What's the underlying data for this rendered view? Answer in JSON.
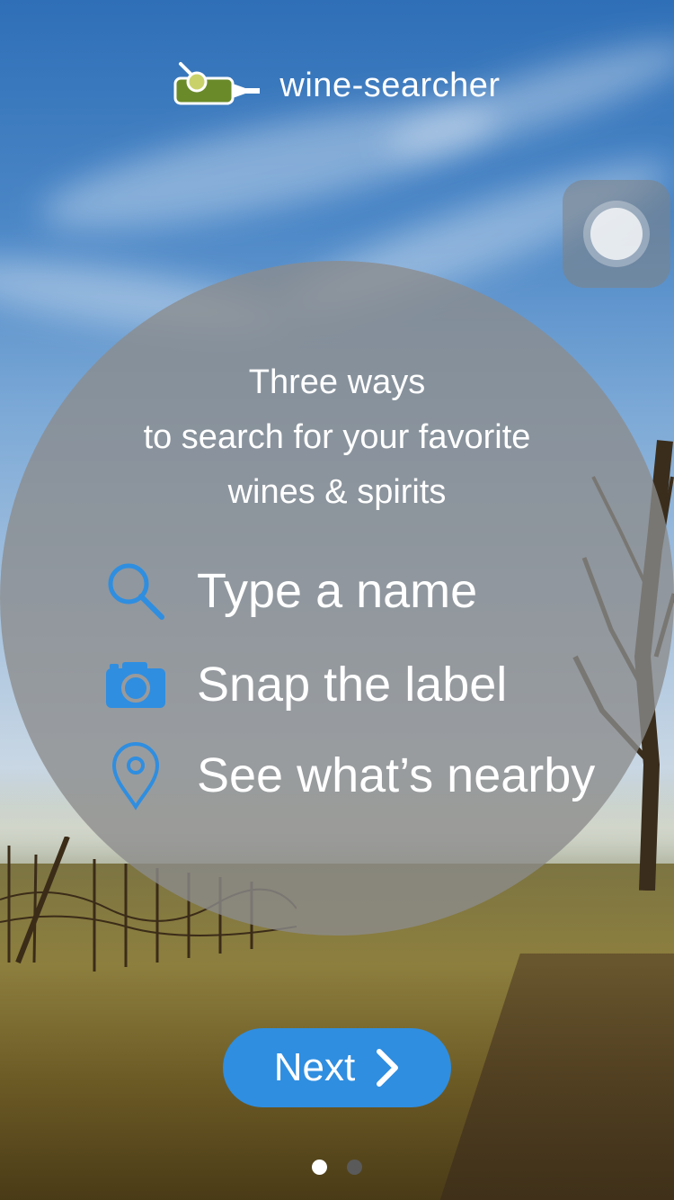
{
  "brand": {
    "name": "wine-searcher",
    "logo_icon": "wine-bottle-magnifier-icon",
    "logo_color": "#6a8a2a"
  },
  "headline": {
    "line1": "Three ways",
    "line2": "to search for your favorite",
    "line3": "wines & spirits"
  },
  "options": [
    {
      "icon": "search-icon",
      "label": "Type a name"
    },
    {
      "icon": "camera-icon",
      "label": "Snap the label"
    },
    {
      "icon": "location-pin-icon",
      "label": "See what’s nearby"
    }
  ],
  "next_button": {
    "label": "Next",
    "icon": "chevron-right-icon",
    "color": "#2f8ee0"
  },
  "pager": {
    "total": 2,
    "current": 1,
    "active_color": "#ffffff",
    "inactive_color": "#5a5a5a"
  },
  "colors": {
    "accent_blue": "#2f8ee0",
    "overlay_gray": "#8c8c8c"
  }
}
